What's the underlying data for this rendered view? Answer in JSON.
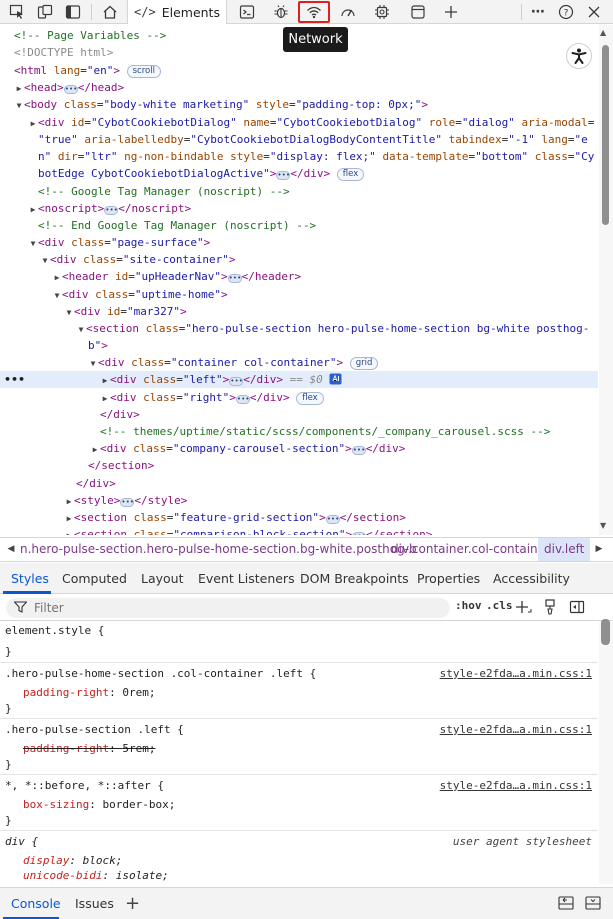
{
  "toolbar": {
    "elements_tab": "Elements",
    "tooltip": "Network",
    "icons": [
      "inspect-icon",
      "device-toolbar-icon",
      "dock-icon",
      "welcome-home-icon",
      "console-icon",
      "sources-bug-icon",
      "network-wifi-icon",
      "performance-icon",
      "memory-chip-icon",
      "application-icon",
      "add-tool-icon",
      "more-options-icon",
      "help-icon",
      "close-icon"
    ]
  },
  "dom": {
    "lines": [
      {
        "t": "comment",
        "text": "<!-- Page Variables -->"
      },
      {
        "t": "comment",
        "text": "<!DOCTYPE html>"
      },
      {
        "t": "html_open",
        "tag": "html",
        "attr": "lang",
        "val": "en",
        "badge": "scroll"
      },
      {
        "t": "collapsed_head",
        "text": "head"
      },
      {
        "t": "body_open",
        "body_class": "body-white marketing",
        "body_style": "padding-top: 0px;"
      },
      {
        "t": "raw",
        "text": "<div id=\"CybotCookiebotDialog\" name=\"CybotCookiebotDialog\" role=\"dialog\" aria-modal="
      },
      {
        "t": "raw",
        "text": "\"true\" aria-labelledby=\"CybotCookiebotDialogBodyContentTitle\" tabindex=\"-1\" lang=\"e"
      },
      {
        "t": "raw",
        "text": "n\" dir=\"ltr\" ng-non-bindable style=\"display: flex;\" data-template=\"bottom\" class=\"Cy"
      },
      {
        "t": "raw",
        "text": "botEdge CybotCookiebotDialogActive\">"
      },
      {
        "t": "comment",
        "text": "<!-- Google Tag Manager (noscript) -->"
      },
      {
        "t": "raw",
        "text": "noscript"
      },
      {
        "t": "comment",
        "text": "<!-- End Google Tag Manager (noscript) -->"
      },
      {
        "t": "raw",
        "text": "page-surface"
      },
      {
        "t": "raw",
        "text": "site-container"
      },
      {
        "t": "raw",
        "text": "upHeaderNav"
      },
      {
        "t": "raw",
        "text": "uptime-home"
      },
      {
        "t": "raw",
        "text": "mar327"
      },
      {
        "t": "raw",
        "text": "hero-pulse-section hero-pulse-home-section bg-white posthog-"
      },
      {
        "t": "raw",
        "text": "b"
      },
      {
        "t": "raw",
        "text": "container col-container"
      },
      {
        "t": "raw",
        "text": "left"
      },
      {
        "t": "raw",
        "text": "right"
      },
      {
        "t": "raw",
        "text": "div-close"
      },
      {
        "t": "comment",
        "text": "<!-- themes/uptime/static/scss/components/_company_carousel.scss -->"
      },
      {
        "t": "raw",
        "text": "company-carousel-section"
      },
      {
        "t": "raw",
        "text": "section-close"
      },
      {
        "t": "raw",
        "text": "div-close"
      },
      {
        "t": "raw",
        "text": "style"
      },
      {
        "t": "raw",
        "text": "feature-grid-section"
      },
      {
        "t": "raw",
        "text": "comparison-block-section"
      }
    ],
    "badges": {
      "scroll": "scroll",
      "flex": "flex",
      "grid": "grid"
    },
    "selected_suffix": "== $0",
    "gutter_dots": "•••"
  },
  "breadcrumbs": [
    {
      "label": "n.hero-pulse-section.hero-pulse-home-section.bg-white.posthog-b",
      "active": false
    },
    {
      "label": "div.container.col-container",
      "active": false
    },
    {
      "label": "div.left",
      "active": true
    }
  ],
  "subtabs": [
    "Styles",
    "Computed",
    "Layout",
    "Event Listeners",
    "DOM Breakpoints",
    "Properties",
    "Accessibility"
  ],
  "filter": {
    "placeholder": "Filter",
    "hov": ":hov",
    "cls": ".cls"
  },
  "rules": [
    {
      "selector": "element.style {",
      "close": "}",
      "source": "",
      "decls": []
    },
    {
      "selector": ".hero-pulse-home-section .col-container .left {",
      "close": "}",
      "source": "style-e2fda…a.min.css:1",
      "decls": [
        {
          "prop": "padding-right",
          "val": "0rem;",
          "struck": false
        }
      ]
    },
    {
      "selector": ".hero-pulse-section .left {",
      "close": "}",
      "source": "style-e2fda…a.min.css:1",
      "decls": [
        {
          "prop": "padding-right",
          "val": "5rem;",
          "struck": true
        }
      ]
    },
    {
      "selector": "*, *::before, *::after {",
      "close": "}",
      "source": "style-e2fda…a.min.css:1",
      "decls": [
        {
          "prop": "box-sizing",
          "val": "border-box;",
          "struck": false
        }
      ]
    },
    {
      "selector": "div {",
      "close": "",
      "source": "user agent stylesheet",
      "decls": [
        {
          "prop": "display",
          "val": "block;",
          "struck": false
        },
        {
          "prop": "unicode-bidi",
          "val": "isolate;",
          "struck": false
        }
      ]
    }
  ],
  "drawer": {
    "tabs": [
      "Console",
      "Issues"
    ],
    "add": "+"
  },
  "colors": {
    "accent": "#0b57d0",
    "highlight_box": "#e0201f",
    "selected_row": "#e3ecfa",
    "tag": "#881280",
    "attr_name": "#994500",
    "attr_value": "#1a1aa6",
    "comment": "#236e25"
  }
}
